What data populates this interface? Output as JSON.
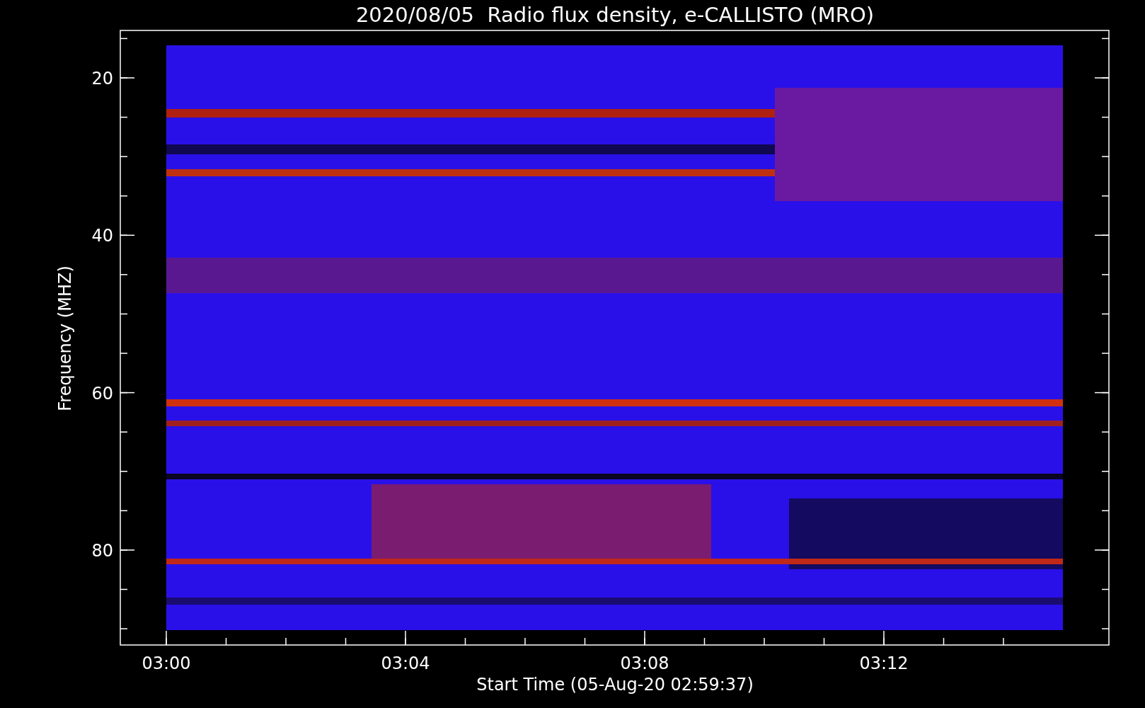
{
  "title": "2020/08/05  Radio flux density, e-CALLISTO (MRO)",
  "y_axis": {
    "label": "Frequency (MHZ)",
    "ticks": [
      "20",
      "40",
      "60",
      "80"
    ]
  },
  "x_axis": {
    "label": "Start Time (05-Aug-20 02:59:37)",
    "ticks": [
      "03:00",
      "03:04",
      "03:08",
      "03:12"
    ]
  }
}
